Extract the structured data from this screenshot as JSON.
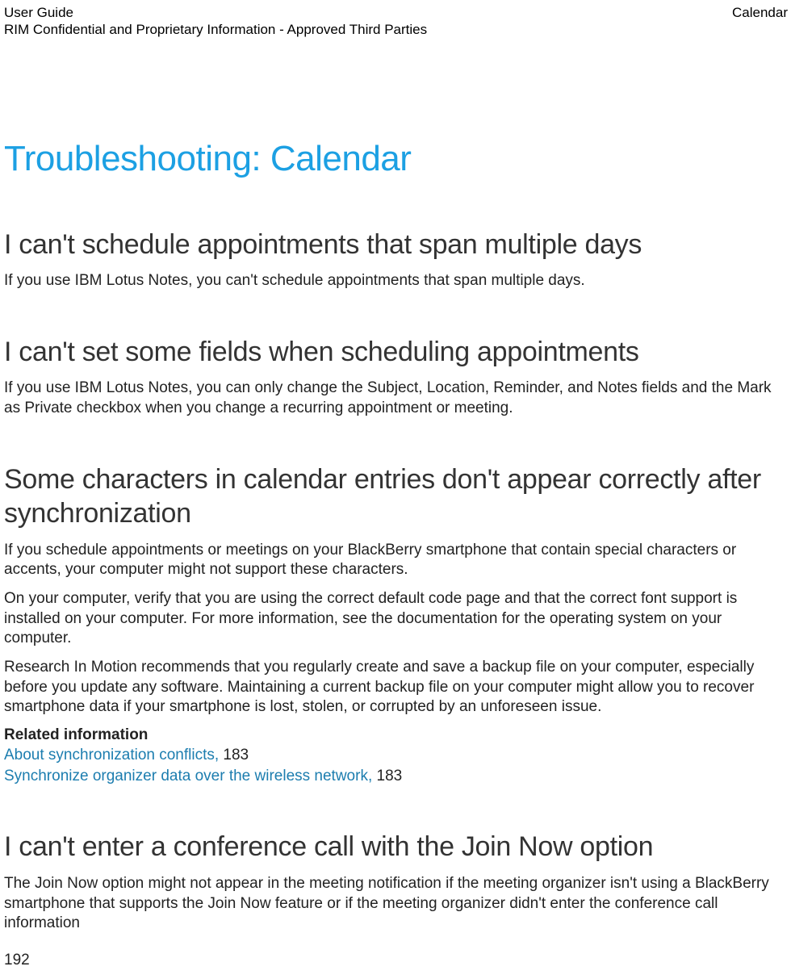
{
  "header": {
    "left_line1": "User Guide",
    "left_line2": "RIM Confidential and Proprietary Information - Approved Third Parties",
    "right": "Calendar"
  },
  "title": "Troubleshooting: Calendar",
  "sections": {
    "s1": {
      "heading": "I can't schedule appointments that span multiple days",
      "p1": "If you use IBM Lotus Notes, you can't schedule appointments that span multiple days."
    },
    "s2": {
      "heading": "I can't set some fields when scheduling appointments",
      "p1": "If you use IBM Lotus Notes, you can only change the Subject, Location, Reminder, and Notes fields and the Mark as Private checkbox when you change a recurring appointment or meeting."
    },
    "s3": {
      "heading": "Some characters in calendar entries don't appear correctly after synchronization",
      "p1": "If you schedule appointments or meetings on your BlackBerry smartphone that contain special characters or accents, your computer might not support these characters.",
      "p2": "On your computer, verify that you are using the correct default code page and that the correct font support is installed on your computer. For more information, see the documentation for the operating system on your computer.",
      "p3": "Research In Motion recommends that you regularly create and save a backup file on your computer, especially before you update any software. Maintaining a current backup file on your computer might allow you to recover smartphone data if your smartphone is lost, stolen, or corrupted by an unforeseen issue.",
      "related_label": "Related information",
      "related": [
        {
          "text": "About synchronization conflicts, ",
          "page": "183"
        },
        {
          "text": "Synchronize organizer data over the wireless network, ",
          "page": "183"
        }
      ]
    },
    "s4": {
      "heading": "I can't enter a conference call with the Join Now option",
      "p1": "The Join Now option might not appear in the meeting notification if the meeting organizer isn't using a BlackBerry smartphone that supports the Join Now feature or if the meeting organizer didn't enter the conference call information"
    }
  },
  "page_number": "192"
}
